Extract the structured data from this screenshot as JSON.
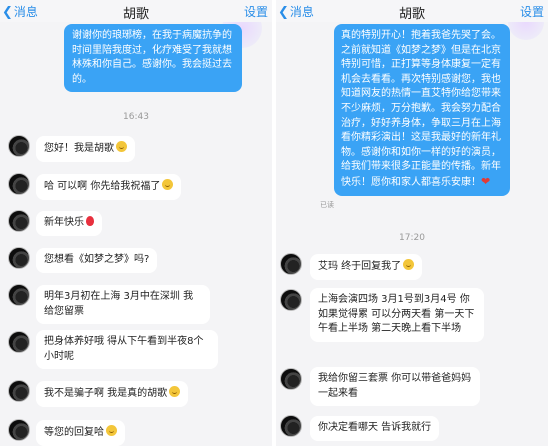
{
  "left": {
    "header": {
      "back": "消息",
      "title": "胡歌",
      "settings": "设置"
    },
    "messages": [
      {
        "type": "out",
        "text": "谢谢你的琅琊榜，在我于病魔抗争的时间里陪我度过，化疗难受了我就想林殊和你自己。感谢你。我会挺过去的。"
      },
      {
        "type": "time",
        "text": "16:43"
      },
      {
        "type": "in",
        "text": "您好！我是胡歌",
        "emoji": "smile"
      },
      {
        "type": "in",
        "text": "哈 可以啊 你先给我祝福了",
        "emoji": "smile"
      },
      {
        "type": "in",
        "text": "新年快乐",
        "emoji": "balloon"
      },
      {
        "type": "in",
        "text": "您想看《如梦之梦》吗?"
      },
      {
        "type": "in",
        "text": "明年3月初在上海 3月中在深圳 我给您留票"
      },
      {
        "type": "in",
        "text": "把身体养好哦 得从下午看到半夜8个小时呢"
      },
      {
        "type": "in",
        "text": "我不是骗子啊 我是真的胡歌",
        "emoji": "smile"
      },
      {
        "type": "in",
        "text": "等您的回复哈",
        "emoji": "smile"
      }
    ]
  },
  "right": {
    "header": {
      "back": "消息",
      "title": "胡歌",
      "settings": "设置"
    },
    "messages": [
      {
        "type": "out",
        "text": "真的特别开心！抱着我爸先哭了会。之前就知道《如梦之梦》但是在北京特别可惜，正打算等身体康复一定有机会去看看。再次特别感谢您，我也知道网友的热情一直艾特你给您带来不少麻烦，万分抱歉。我会努力配合治疗，好好养身体，争取三月在上海看你精彩演出！这是我最好的新年礼物。感谢你和如你一样的好的演员，给我们带来很多正能量的传播。新年快乐！愿你和家人都喜乐安康！",
        "emoji": "heart"
      },
      {
        "type": "read",
        "text": "已读"
      },
      {
        "type": "time",
        "text": "17:20"
      },
      {
        "type": "in",
        "text": "艾玛 终于回复我了",
        "emoji": "smile"
      },
      {
        "type": "in",
        "text": "上海会演四场 3月1号到3月4号 你如果觉得累 可以分两天看 第一天下午看上半场 第二天晚上看下半场"
      },
      {
        "type": "in",
        "text": "我给你留三套票 你可以带爸爸妈妈一起来看"
      },
      {
        "type": "in",
        "text": "你决定看哪天 告诉我就行"
      }
    ]
  },
  "colors": {
    "accent": "#2a8ee8",
    "outgoing_bubble": "#3aa3f5",
    "incoming_bubble": "#ffffff",
    "background": "#f4f4f6"
  }
}
